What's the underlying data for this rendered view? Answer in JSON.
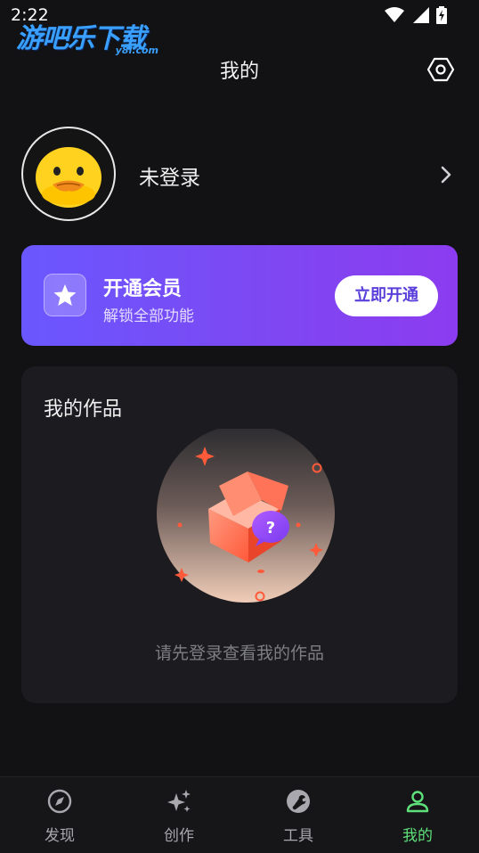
{
  "status_bar": {
    "time": "2:22"
  },
  "watermark": {
    "text": "游吧乐下载",
    "sub": "y8l.com"
  },
  "header": {
    "title": "我的"
  },
  "profile": {
    "username": "未登录"
  },
  "vip": {
    "title": "开通会员",
    "subtitle": "解锁全部功能",
    "button": "立即开通"
  },
  "works": {
    "title": "我的作品",
    "empty_text": "请先登录查看我的作品"
  },
  "tabs": [
    {
      "label": "发现",
      "icon": "compass-icon"
    },
    {
      "label": "创作",
      "icon": "sparkle-icon"
    },
    {
      "label": "工具",
      "icon": "wrench-icon"
    },
    {
      "label": "我的",
      "icon": "person-icon",
      "active": true
    }
  ],
  "colors": {
    "background": "#121214",
    "accent": "#5ee07a",
    "vip_start": "#6a57ff",
    "vip_end": "#8c3cf0",
    "illustration": "#ff6a4d"
  }
}
